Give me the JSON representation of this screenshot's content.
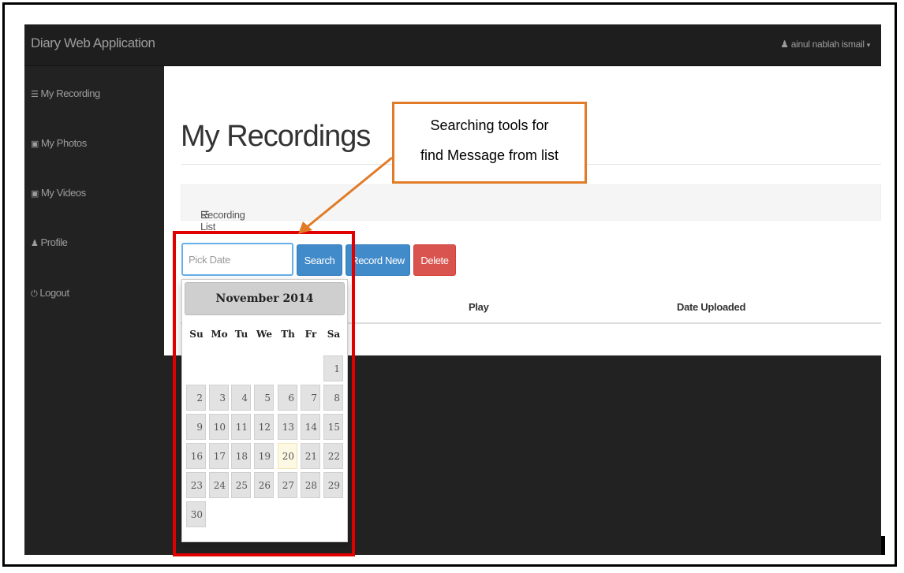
{
  "app": {
    "brand": "Diary Web Application",
    "user_name": "ainul nablah ismail",
    "user_caret": "▾"
  },
  "sidebar": {
    "items": [
      {
        "label": "My Recording",
        "icon": "list-icon",
        "glyph": "☰"
      },
      {
        "label": "My Photos",
        "icon": "file-image-icon",
        "glyph": "▣"
      },
      {
        "label": "My Videos",
        "icon": "file-video-icon",
        "glyph": "▣"
      },
      {
        "label": "Profile",
        "icon": "user-icon",
        "glyph": "♟"
      },
      {
        "label": "Logout",
        "icon": "power-icon",
        "glyph": "⏻"
      }
    ]
  },
  "main": {
    "title": "My Recordings",
    "panel_title": "Recording List",
    "panel_icon": "list-icon",
    "date_input": {
      "placeholder": "Pick Date"
    },
    "buttons": {
      "search": "Search",
      "record_new": "Record New",
      "delete": "Delete"
    },
    "table_headers": [
      "Play",
      "Date Uploaded"
    ]
  },
  "datepicker": {
    "month_label": "November 2014",
    "weekdays": [
      "Su",
      "Mo",
      "Tu",
      "We",
      "Th",
      "Fr",
      "Sa"
    ],
    "weeks": [
      [
        "",
        "",
        "",
        "",
        "",
        "",
        "1"
      ],
      [
        "2",
        "3",
        "4",
        "5",
        "6",
        "7",
        "8"
      ],
      [
        "9",
        "10",
        "11",
        "12",
        "13",
        "14",
        "15"
      ],
      [
        "16",
        "17",
        "18",
        "19",
        "20",
        "21",
        "22"
      ],
      [
        "23",
        "24",
        "25",
        "26",
        "27",
        "28",
        "29"
      ],
      [
        "30",
        "",
        "",
        "",
        "",
        "",
        ""
      ]
    ],
    "highlighted_day": "20"
  },
  "annotation": {
    "line1": "Searching tools for",
    "line2": "find Message from list",
    "box_color": "#e07b27",
    "highlight_color": "#e00000"
  }
}
